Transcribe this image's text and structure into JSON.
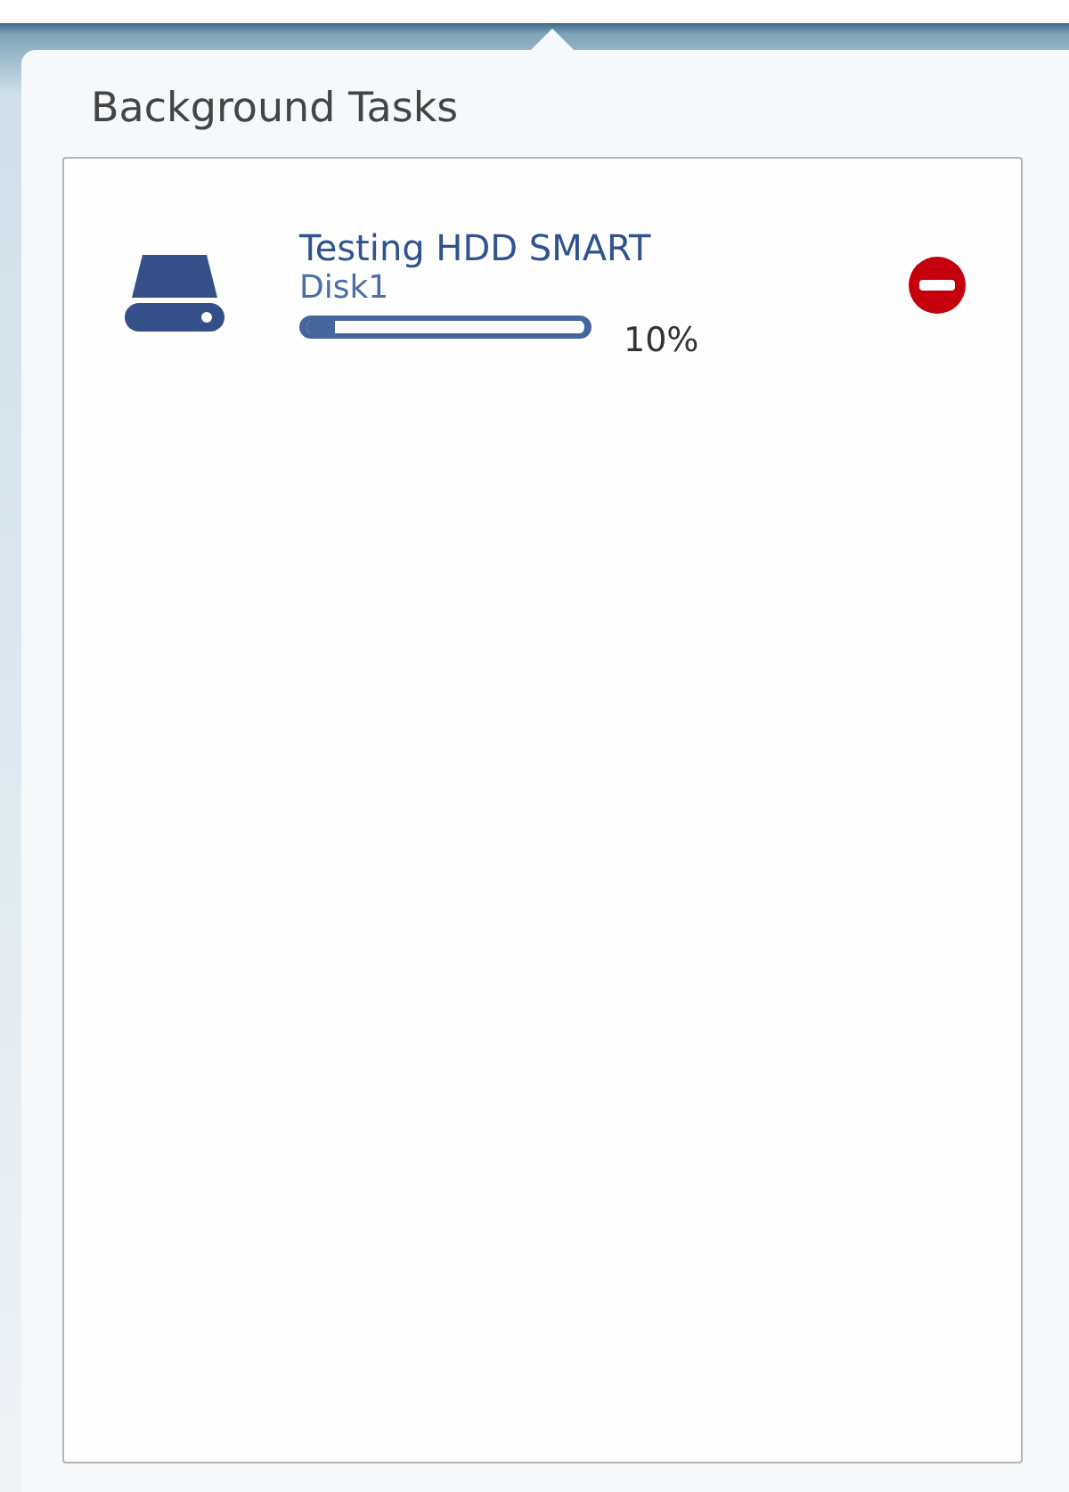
{
  "panel": {
    "title": "Background Tasks"
  },
  "tasks": [
    {
      "name": "Testing HDD SMART",
      "target": "Disk1",
      "level": 0.1,
      "percent": "10%"
    }
  ]
}
